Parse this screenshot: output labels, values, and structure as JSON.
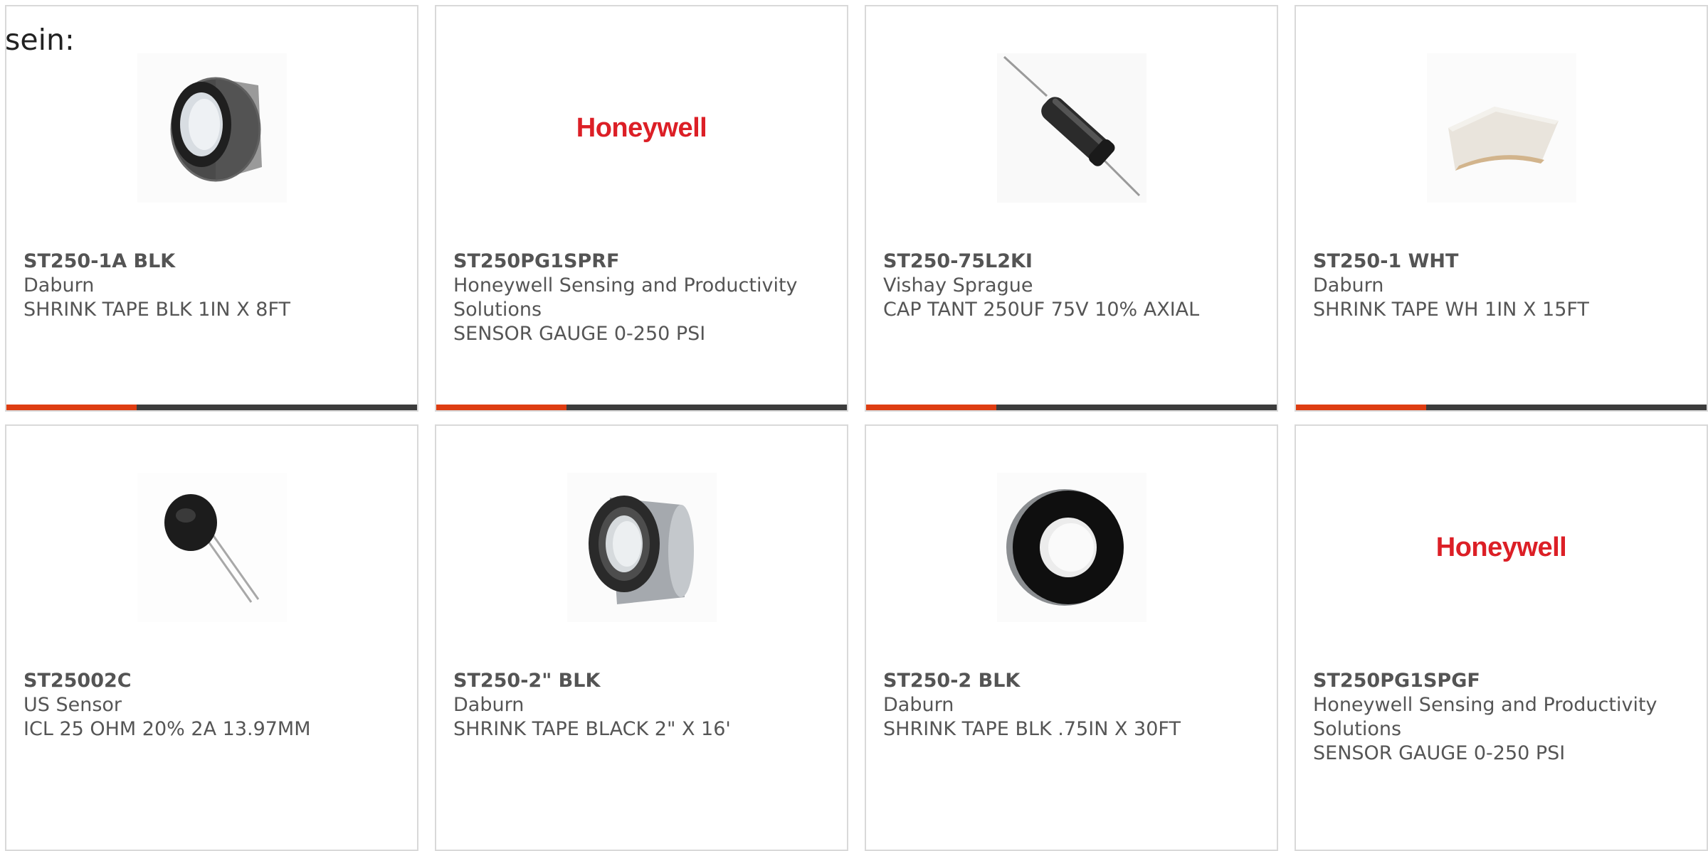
{
  "page": {
    "prefix_text": "sein:"
  },
  "products": [
    {
      "part_number": "ST250-1A BLK",
      "manufacturer": "Daburn",
      "description": "SHRINK TAPE BLK 1IN X 8FT",
      "image": "black-tape-roll"
    },
    {
      "part_number": "ST250PG1SPRF",
      "manufacturer": "Honeywell Sensing and Productivity Solutions",
      "description": "SENSOR GAUGE 0-250 PSI",
      "image": "honeywell-logo",
      "logo_text": "Honeywell"
    },
    {
      "part_number": "ST250-75L2KI",
      "manufacturer": "Vishay Sprague",
      "description": "CAP TANT 250UF 75V 10% AXIAL",
      "image": "axial-capacitor"
    },
    {
      "part_number": "ST250-1 WHT",
      "manufacturer": "Daburn",
      "description": "SHRINK TAPE WH 1IN X 15FT",
      "image": "white-tape"
    },
    {
      "part_number": "ST25002C",
      "manufacturer": "US Sensor",
      "description": "ICL 25 OHM 20% 2A 13.97MM",
      "image": "disc-thermistor"
    },
    {
      "part_number": "ST250-2\" BLK",
      "manufacturer": "Daburn",
      "description": "SHRINK TAPE BLACK 2\" X 16'",
      "image": "black-tape-roll-wide"
    },
    {
      "part_number": "ST250-2 BLK",
      "manufacturer": "Daburn",
      "description": "SHRINK TAPE BLK .75IN X 30FT",
      "image": "black-tape-roll-front"
    },
    {
      "part_number": "ST250PG1SPGF",
      "manufacturer": "Honeywell Sensing and Productivity Solutions",
      "description": "SENSOR GAUGE 0-250 PSI",
      "image": "honeywell-logo",
      "logo_text": "Honeywell"
    }
  ],
  "colors": {
    "accent": "#de3d12",
    "bar": "#3c3c3c",
    "brand_red": "#dc1f26",
    "text": "#555555",
    "border": "#d9d9d9"
  }
}
